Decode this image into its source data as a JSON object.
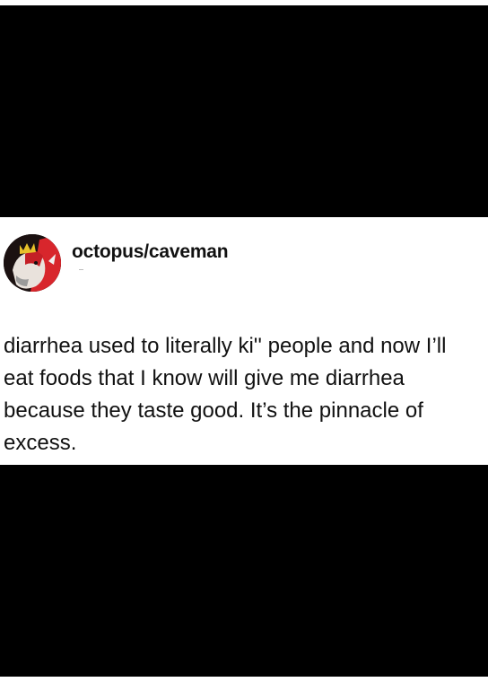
{
  "post": {
    "username": "octopus/caveman",
    "body": "diarrhea used to literally ki'' people and now I’ll eat foods that I know will give me diarrhea because they taste good. It’s the pinnacle of excess.",
    "avatar_icon": "crowned-dog-avatar"
  },
  "colors": {
    "background": "#ffffff",
    "frame": "#000000",
    "text": "#111111",
    "avatar_red": "#d8262c",
    "avatar_gold": "#e8c12a"
  }
}
